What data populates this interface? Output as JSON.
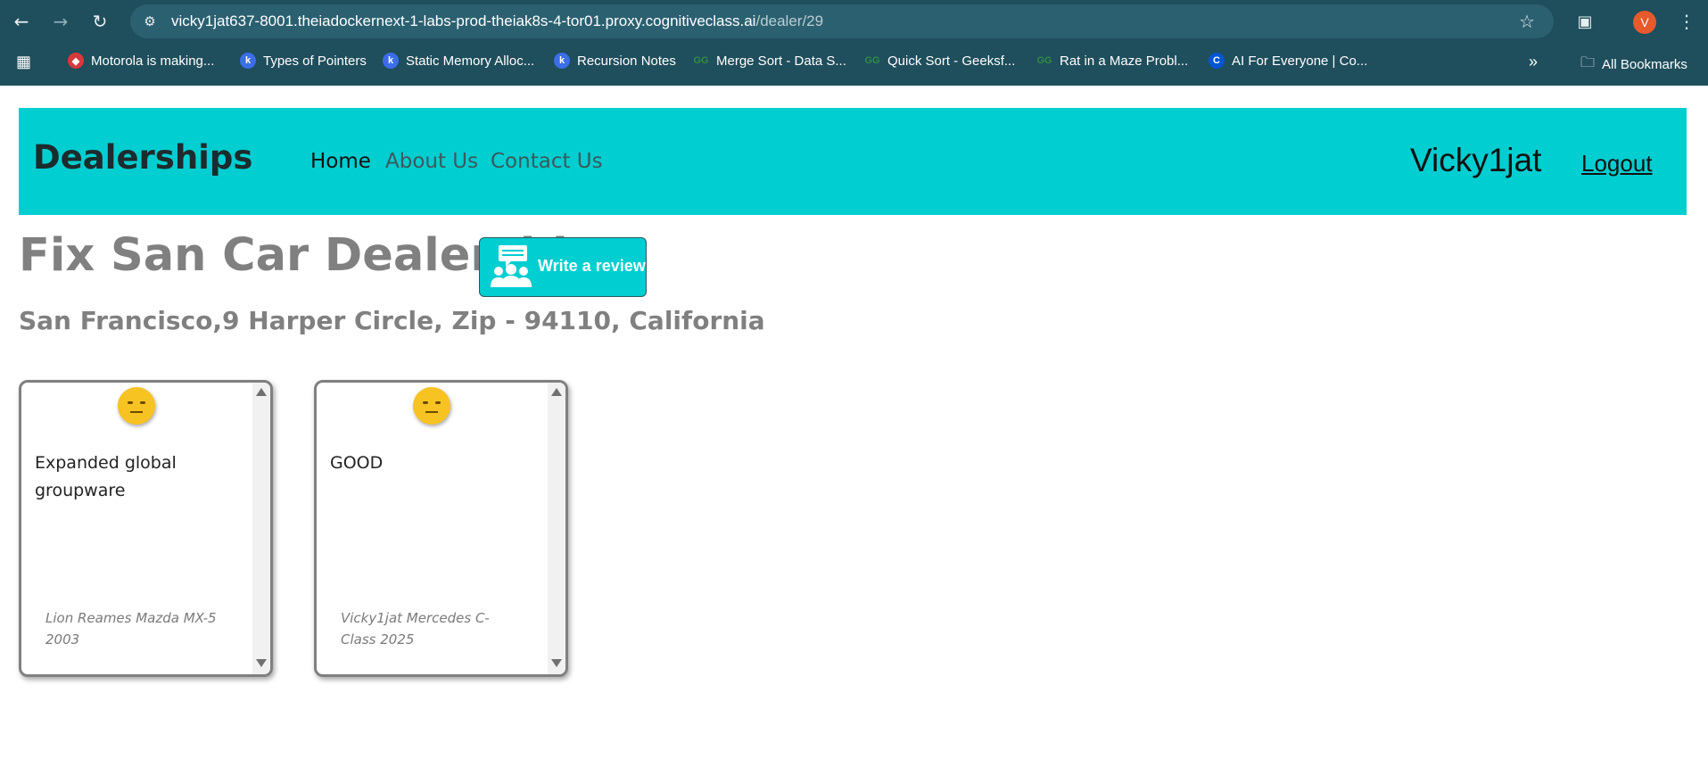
{
  "browser": {
    "url_host": "vicky1jat637-8001.theiadockernext-1-labs-prod-theiak8s-4-tor01.proxy.cognitiveclass.ai",
    "url_path": "/dealer/29",
    "profile_initial": "V",
    "bookmarks": [
      {
        "label": "Motorola is making...",
        "icon": "shield-icon",
        "color": "#d63a3a"
      },
      {
        "label": "Types of Pointers",
        "icon": "k-icon",
        "color": "#3b6ee8"
      },
      {
        "label": "Static Memory Alloc...",
        "icon": "k-icon",
        "color": "#3b6ee8"
      },
      {
        "label": "Recursion Notes",
        "icon": "k-icon",
        "color": "#3b6ee8"
      },
      {
        "label": "Merge Sort - Data S...",
        "icon": "gfg-icon",
        "color": "#2f8d46"
      },
      {
        "label": "Quick Sort - Geeksf...",
        "icon": "gfg-icon",
        "color": "#2f8d46"
      },
      {
        "label": "Rat in a Maze Probl...",
        "icon": "gfg-icon",
        "color": "#2f8d46"
      },
      {
        "label": "AI For Everyone | Co...",
        "icon": "coursera-icon",
        "color": "#0056d2"
      }
    ],
    "all_bookmarks_label": "All Bookmarks"
  },
  "navbar": {
    "brand": "Dealerships",
    "links": [
      "Home",
      "About Us",
      "Contact Us"
    ],
    "username": "Vicky1jat",
    "logout": "Logout",
    "accent": "#00ced1"
  },
  "dealer": {
    "name": "Fix San Car Dealership",
    "address": "San Francisco,9 Harper Circle, Zip - 94110, California",
    "review_button": "Write a review"
  },
  "reviews": [
    {
      "text": "Expanded global groupware",
      "reviewer": "Lion Reames Mazda MX-5 2003",
      "sentiment_icon": "neutral-emoji-icon"
    },
    {
      "text": "GOOD",
      "reviewer": "Vicky1jat Mercedes C-Class 2025",
      "sentiment_icon": "neutral-emoji-icon"
    }
  ]
}
